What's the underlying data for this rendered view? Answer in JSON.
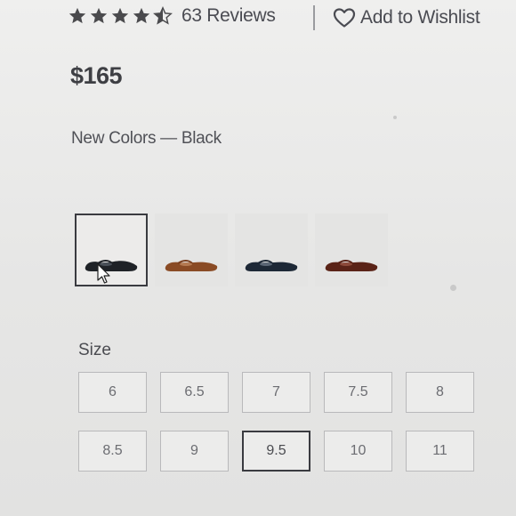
{
  "rating": {
    "stars": 4.5,
    "reviews_label": "63 Reviews"
  },
  "wishlist": {
    "label": "Add to Wishlist",
    "icon": "heart-outline-icon"
  },
  "price": "$165",
  "color": {
    "line": "New Colors — Black"
  },
  "swatches": [
    {
      "name": "black",
      "color": "#1f2227",
      "selected": true
    },
    {
      "name": "cognac",
      "color": "#8a4b25",
      "selected": false
    },
    {
      "name": "navy",
      "color": "#1d2836",
      "selected": false
    },
    {
      "name": "burgundy",
      "color": "#5a2317",
      "selected": false
    }
  ],
  "size": {
    "label": "Size",
    "rows": [
      [
        "6",
        "6.5",
        "7",
        "7.5",
        "8"
      ],
      [
        "8.5",
        "9",
        "9.5",
        "10",
        "11"
      ]
    ],
    "selected": "9.5"
  },
  "colors": {
    "star": "#4a4a4d",
    "text": "#4a4b52",
    "selected_border": "#3a3b40"
  }
}
